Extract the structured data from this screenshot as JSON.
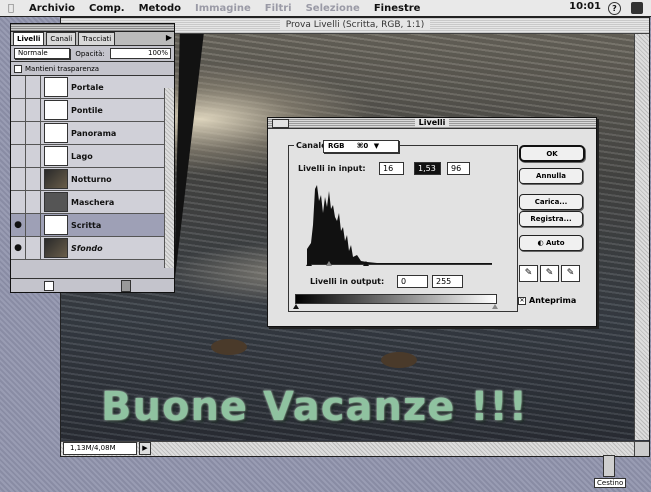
{
  "menubar": {
    "items": [
      "Archivio",
      "Comp.",
      "Metodo",
      "Immagine",
      "Filtri",
      "Selezione",
      "Finestre"
    ],
    "dimmed": [
      false,
      false,
      false,
      true,
      true,
      true,
      false
    ],
    "clock": "10:01",
    "help_icon": "help-icon",
    "app_icon": "photoshop-app-icon"
  },
  "document": {
    "title": "Prova Livelli (Scritta, RGB, 1:1)",
    "text_overlay": "Buone Vacanze !!!",
    "size_field": "1,13M/4,08M"
  },
  "layers_palette": {
    "tabs": [
      "Livelli",
      "Canali",
      "Tracciati"
    ],
    "active_tab": "Livelli",
    "mode": "Normale",
    "opacity_label": "Opacità:",
    "opacity_value": "100%",
    "preserve_label": "Mantieni trasparenza",
    "layers": [
      {
        "name": "Portale",
        "visible": false,
        "selected": false,
        "italic": false
      },
      {
        "name": "Pontile",
        "visible": false,
        "selected": false,
        "italic": false
      },
      {
        "name": "Panorama",
        "visible": false,
        "selected": false,
        "italic": false
      },
      {
        "name": "Lago",
        "visible": false,
        "selected": false,
        "italic": false
      },
      {
        "name": "Notturno",
        "visible": false,
        "selected": false,
        "italic": false
      },
      {
        "name": "Maschera",
        "visible": false,
        "selected": false,
        "italic": false
      },
      {
        "name": "Scritta",
        "visible": true,
        "selected": true,
        "italic": false
      },
      {
        "name": "Sfondo",
        "visible": true,
        "selected": false,
        "italic": true
      }
    ]
  },
  "levels_dialog": {
    "title": "Livelli",
    "channel_label": "Canale:",
    "channel_value": "RGB",
    "channel_shortcut": "⌘0",
    "input_label": "Livelli in input:",
    "input_values": [
      "16",
      "1,53",
      "96"
    ],
    "output_label": "Livelli in output:",
    "output_values": [
      "0",
      "255"
    ],
    "buttons": {
      "ok": "OK",
      "cancel": "Annulla",
      "load": "Carica...",
      "save": "Registra...",
      "auto": "Auto"
    },
    "preview_label": "Anteprima",
    "preview_checked": true
  },
  "desktop": {
    "trash_label": "Cestino"
  }
}
